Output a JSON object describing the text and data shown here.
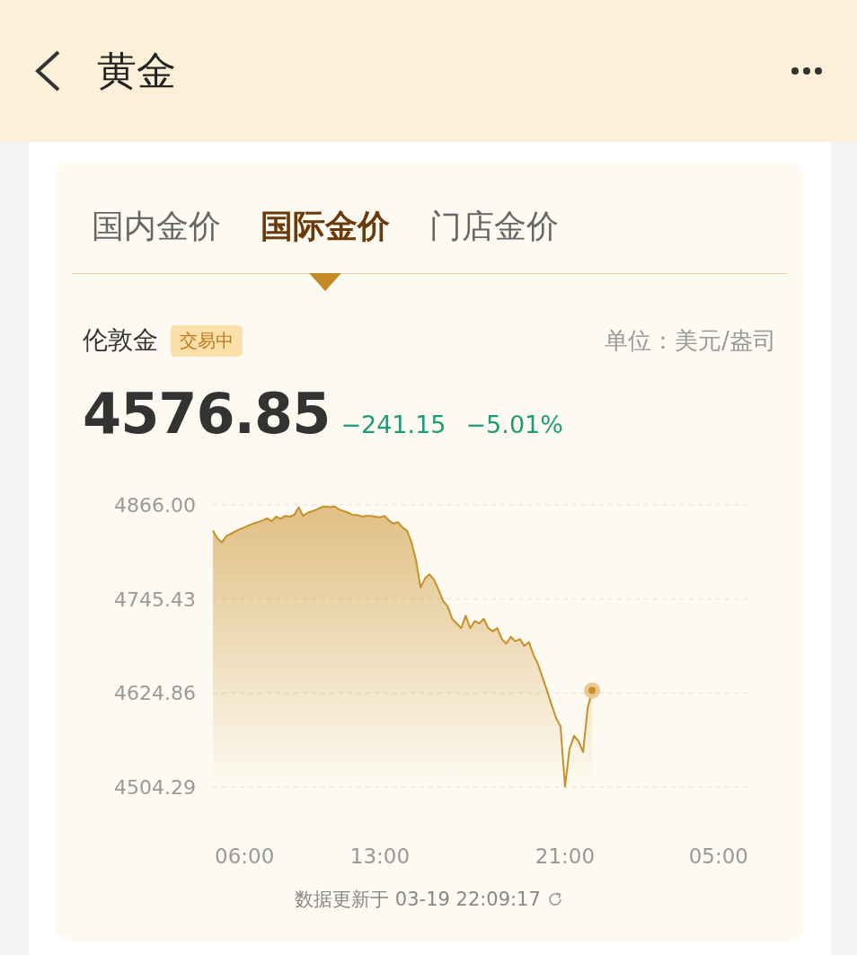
{
  "header": {
    "title": "黄金"
  },
  "tabs": [
    {
      "label": "国内金价",
      "selected": false
    },
    {
      "label": "国际金价",
      "selected": true
    },
    {
      "label": "门店金价",
      "selected": false
    }
  ],
  "quote": {
    "name": "伦敦金",
    "status": "交易中",
    "unit": "单位：美元/盎司",
    "price": "4576.85",
    "change": "−241.15",
    "change_percent": "−5.01%"
  },
  "chart": {
    "chart_data": {
      "type": "area",
      "categories": [
        null,
        null,
        null,
        null,
        null,
        null,
        null,
        "06:00",
        null,
        null,
        null,
        null,
        null,
        null,
        null,
        null,
        null,
        null,
        null,
        null,
        null,
        null,
        null,
        null,
        null,
        null,
        null,
        null,
        null,
        null,
        null,
        null,
        null,
        null,
        null,
        null,
        null,
        "13:00",
        null,
        null,
        null,
        null,
        null,
        null,
        null,
        null,
        null,
        null,
        null,
        null,
        null,
        null,
        null,
        null,
        null,
        null,
        null,
        null,
        null,
        null,
        null,
        null,
        null,
        null,
        null,
        null,
        null,
        null,
        null,
        null,
        null,
        null,
        null,
        null,
        null,
        null,
        null,
        null,
        "21:00",
        null,
        null,
        null,
        null,
        null,
        null,
        null,
        null,
        null,
        null,
        null,
        null,
        null,
        null,
        null,
        null,
        null,
        null,
        null,
        null,
        null,
        null,
        null,
        null,
        null,
        null,
        null,
        null,
        null,
        null,
        null,
        null,
        null,
        "05:00",
        null,
        null,
        null,
        null,
        null,
        null,
        null
      ],
      "series": [
        {
          "color": "#c8902a",
          "values": [
            4833,
            4823,
            4818,
            4826,
            4829,
            4832,
            4835,
            4837,
            4840,
            4842,
            4844,
            4846,
            4849,
            4845,
            4851,
            4848,
            4852,
            4851,
            4853,
            4863,
            4852,
            4856,
            4858,
            4860,
            4863,
            4864,
            4863,
            4864,
            4860,
            4858,
            4856,
            4853,
            4853,
            4851,
            4852,
            4852,
            4851,
            4850,
            4852,
            4846,
            4842,
            4844,
            4837,
            4833,
            4818,
            4795,
            4760,
            4772,
            4777,
            4770,
            4757,
            4743,
            4736,
            4720,
            4714,
            4708,
            4724,
            4708,
            4717,
            4714,
            4720,
            4708,
            4704,
            4708,
            4694,
            4688,
            4697,
            4691,
            4694,
            4685,
            4690,
            4674,
            4662,
            4645,
            4628,
            4610,
            4593,
            4582,
            4505,
            4553,
            4570,
            4563,
            4549,
            4605,
            4628,
            null,
            null,
            null,
            null,
            null,
            null,
            null,
            null,
            null,
            null,
            null,
            null,
            null,
            null,
            null,
            null,
            null,
            null,
            null,
            null,
            null,
            null,
            null,
            null,
            null,
            null,
            null,
            null,
            null,
            null,
            null,
            null,
            null,
            null,
            null
          ]
        }
      ],
      "ylim": [
        4504.29,
        4866.0
      ],
      "yticks": [
        {
          "value": 4866.0,
          "label": "4866.00"
        },
        {
          "value": 4745.43,
          "label": "4745.43"
        },
        {
          "value": 4624.86,
          "label": "4624.86"
        },
        {
          "value": 4504.29,
          "label": "4504.29"
        }
      ]
    }
  },
  "footer": {
    "updated": "数据更新于 03-19 22:09:17"
  }
}
